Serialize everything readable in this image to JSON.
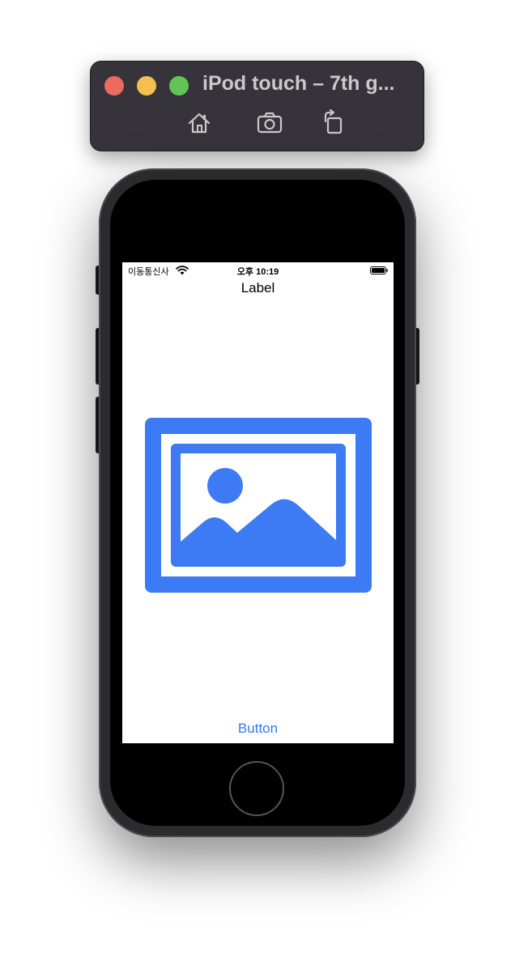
{
  "simulator": {
    "title": "iPod touch – 7th g...",
    "toolbar_icons": [
      "home-icon",
      "camera-icon",
      "rotate-icon"
    ],
    "traffic_colors": {
      "close": "#ec6a5e",
      "minimize": "#f4bf4f",
      "zoom": "#61c554"
    }
  },
  "status_bar": {
    "carrier": "이동통신사",
    "time": "오후 10:19",
    "icons": [
      "wifi-icon",
      "battery-icon"
    ]
  },
  "app": {
    "label": "Label",
    "image_icon": "photo-icon",
    "image_color": "#3d7bf5",
    "button_label": "Button",
    "button_color": "#3478f6"
  }
}
